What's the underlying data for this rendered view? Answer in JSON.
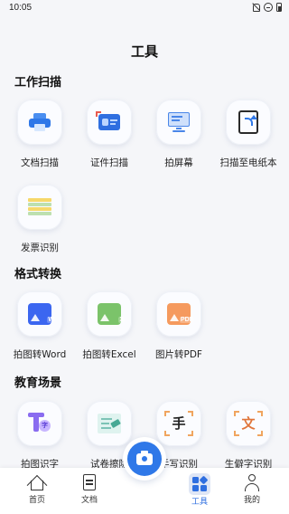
{
  "status_bar": {
    "time": "10:05"
  },
  "page_title": "工具",
  "sections": {
    "scan": {
      "title": "工作扫描",
      "items": [
        {
          "label": "文档扫描",
          "icon": "printer-icon"
        },
        {
          "label": "证件扫描",
          "icon": "id-card-icon"
        },
        {
          "label": "拍屏幕",
          "icon": "monitor-icon"
        },
        {
          "label": "扫描至电纸本",
          "icon": "ebook-icon"
        },
        {
          "label": "发票识别",
          "icon": "invoice-icon"
        }
      ]
    },
    "convert": {
      "title": "格式转换",
      "items": [
        {
          "label": "拍图转Word",
          "icon": "word-icon",
          "badge": "W"
        },
        {
          "label": "拍图转Excel",
          "icon": "excel-icon",
          "badge": "X"
        },
        {
          "label": "图片转PDF",
          "icon": "pdf-icon",
          "badge": "PDF"
        }
      ]
    },
    "education": {
      "title": "教育场景",
      "items": [
        {
          "label": "拍图识字",
          "icon": "text-recognition-icon",
          "glyph": "字"
        },
        {
          "label": "试卷擦除",
          "icon": "eraser-icon"
        },
        {
          "label": "手写识别",
          "icon": "handwriting-icon",
          "glyph": "手"
        },
        {
          "label": "生僻字识别",
          "icon": "rare-character-icon",
          "glyph": "文"
        }
      ]
    }
  },
  "bottom_nav": {
    "home": "首页",
    "documents": "文档",
    "tools": "工具",
    "me": "我的"
  },
  "colors": {
    "accent": "#2f78e8",
    "background": "#f5f6f9"
  }
}
